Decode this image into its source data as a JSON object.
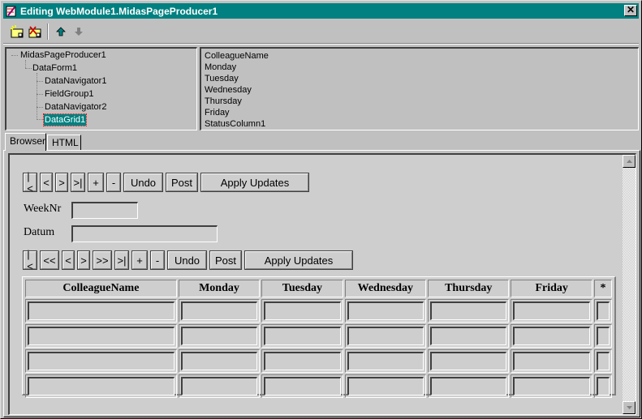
{
  "window": {
    "title": "Editing WebModule1.MidasPageProducer1",
    "close_label": "✕"
  },
  "toolbar": {
    "buttons": [
      {
        "name": "new-item",
        "icon": "new-item-icon"
      },
      {
        "name": "delete-item",
        "icon": "delete-item-icon"
      },
      {
        "name": "move-up",
        "icon": "arrow-up-icon"
      },
      {
        "name": "move-down",
        "icon": "arrow-down-icon"
      }
    ]
  },
  "tree": {
    "items": [
      "MidasPageProducer1",
      "DataForm1",
      "DataNavigator1",
      "FieldGroup1",
      "DataNavigator2",
      "DataGrid1"
    ],
    "selected": "DataGrid1"
  },
  "fields": {
    "items": [
      "ColleagueName",
      "Monday",
      "Tuesday",
      "Wednesday",
      "Thursday",
      "Friday",
      "StatusColumn1"
    ]
  },
  "tabs": {
    "browser": "Browser",
    "html": "HTML"
  },
  "nav1": [
    "|<",
    "<",
    ">",
    ">|",
    "+",
    "-",
    "Undo",
    "Post",
    "Apply Updates"
  ],
  "nav2": [
    "|<",
    "<<",
    "<",
    ">",
    ">>",
    ">|",
    "+",
    "-",
    "Undo",
    "Post",
    "Apply Updates"
  ],
  "form": {
    "weeknr_label": "WeekNr",
    "weeknr_value": "",
    "datum_label": "Datum",
    "datum_value": ""
  },
  "grid": {
    "headers": [
      "ColleagueName",
      "Monday",
      "Tuesday",
      "Wednesday",
      "Thursday",
      "Friday",
      "*"
    ],
    "rows": [
      [
        "",
        "",
        "",
        "",
        "",
        "",
        ""
      ],
      [
        "",
        "",
        "",
        "",
        "",
        "",
        ""
      ],
      [
        "",
        "",
        "",
        "",
        "",
        "",
        ""
      ],
      [
        "",
        "",
        "",
        "",
        "",
        "",
        ""
      ]
    ]
  },
  "colors": {
    "titlebar": "#008080",
    "face": "#c0c0c0",
    "selection": "#008080",
    "toolbar_up_arrow": "#008080"
  }
}
